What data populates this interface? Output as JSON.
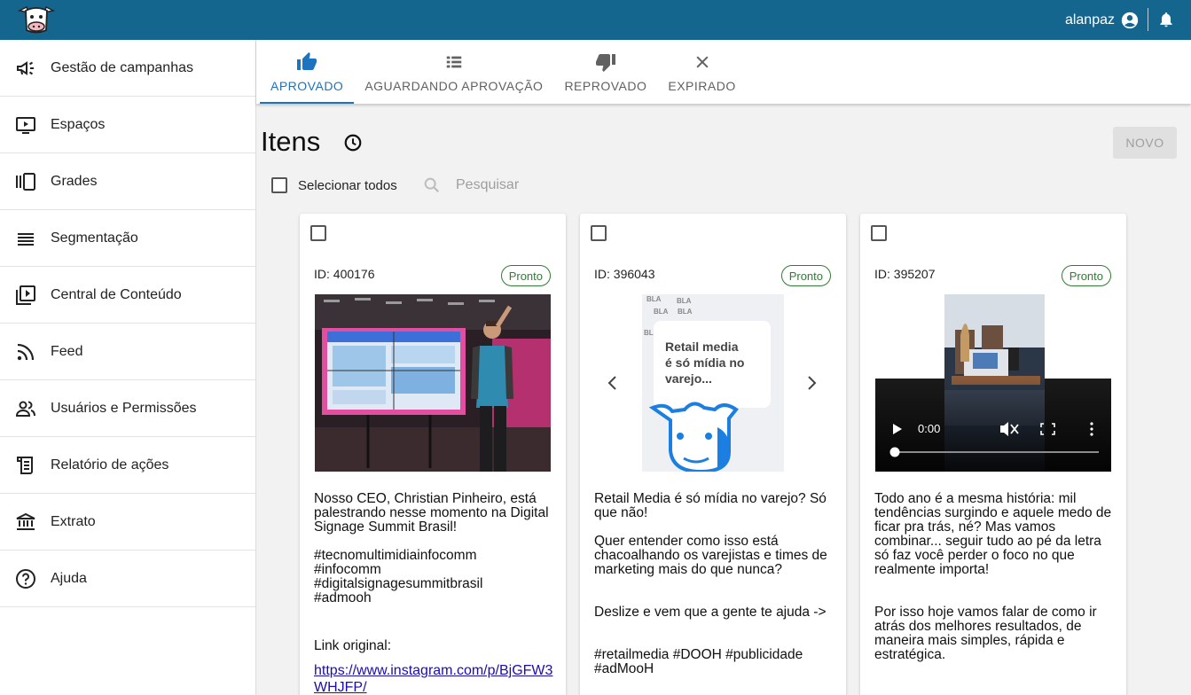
{
  "header": {
    "username": "alanpaz"
  },
  "sidebar": {
    "items": [
      {
        "label": "Gestão de campanhas",
        "icon": "megaphone-icon"
      },
      {
        "label": "Espaços",
        "icon": "play-screen-icon"
      },
      {
        "label": "Grades",
        "icon": "carousel-icon"
      },
      {
        "label": "Segmentação",
        "icon": "list-icon"
      },
      {
        "label": "Central de Conteúdo",
        "icon": "video-library-icon"
      },
      {
        "label": "Feed",
        "icon": "rss-icon"
      },
      {
        "label": "Usuários e Permissões",
        "icon": "people-icon"
      },
      {
        "label": "Relatório de ações",
        "icon": "receipt-icon"
      },
      {
        "label": "Extrato",
        "icon": "bank-icon"
      },
      {
        "label": "Ajuda",
        "icon": "help-icon"
      }
    ]
  },
  "tabs": [
    {
      "label": "APROVADO",
      "icon": "thumb-up-icon",
      "active": true
    },
    {
      "label": "AGUARDANDO APROVAÇÃO",
      "icon": "list-icon",
      "active": false
    },
    {
      "label": "REPROVADO",
      "icon": "thumb-down-icon",
      "active": false
    },
    {
      "label": "EXPIRADO",
      "icon": "close-icon",
      "active": false
    }
  ],
  "main": {
    "title": "Itens",
    "new_button": "NOVO",
    "select_all": "Selecionar todos",
    "search_placeholder": "Pesquisar"
  },
  "cards": [
    {
      "id_label": "ID: 400176",
      "status": "Pronto",
      "p1": "Nosso CEO, Christian Pinheiro, está palestrando nesse momento na Digital Signage Summit Brasil!",
      "p2": "#tecnomultimidiainfocomm\n#infocomm\n#digitalsignagesummitbrasil\n#admooh",
      "p3": "Link original:",
      "link": "https://www.instagram.com/p/BjGFW3WHJFP/"
    },
    {
      "id_label": "ID: 396043",
      "status": "Pronto",
      "slide_text": "Retail media é só mídia no varejo...",
      "p1": "Retail Media é só mídia no varejo? Só que não!",
      "p2": "Quer entender como isso está chacoalhando os varejistas e times de marketing mais do que nunca?",
      "p3": "Deslize e vem que a gente te ajuda ->",
      "p4": "#retailmedia #DOOH #publicidade #adMooH"
    },
    {
      "id_label": "ID: 395207",
      "status": "Pronto",
      "video_time": "0:00",
      "p1": "Todo ano é a mesma história: mil tendências surgindo e aquele medo de ficar pra trás, né? Mas vamos combinar... seguir tudo ao pé da letra só faz você perder o foco no que realmente importa!",
      "p2": "Por isso hoje vamos falar de como ir atrás dos melhores resultados, de maneira mais simples, rápida e estratégica."
    }
  ],
  "colors": {
    "topbar": "#14668f",
    "accent": "#1e73be",
    "status": "#2e7d32"
  }
}
